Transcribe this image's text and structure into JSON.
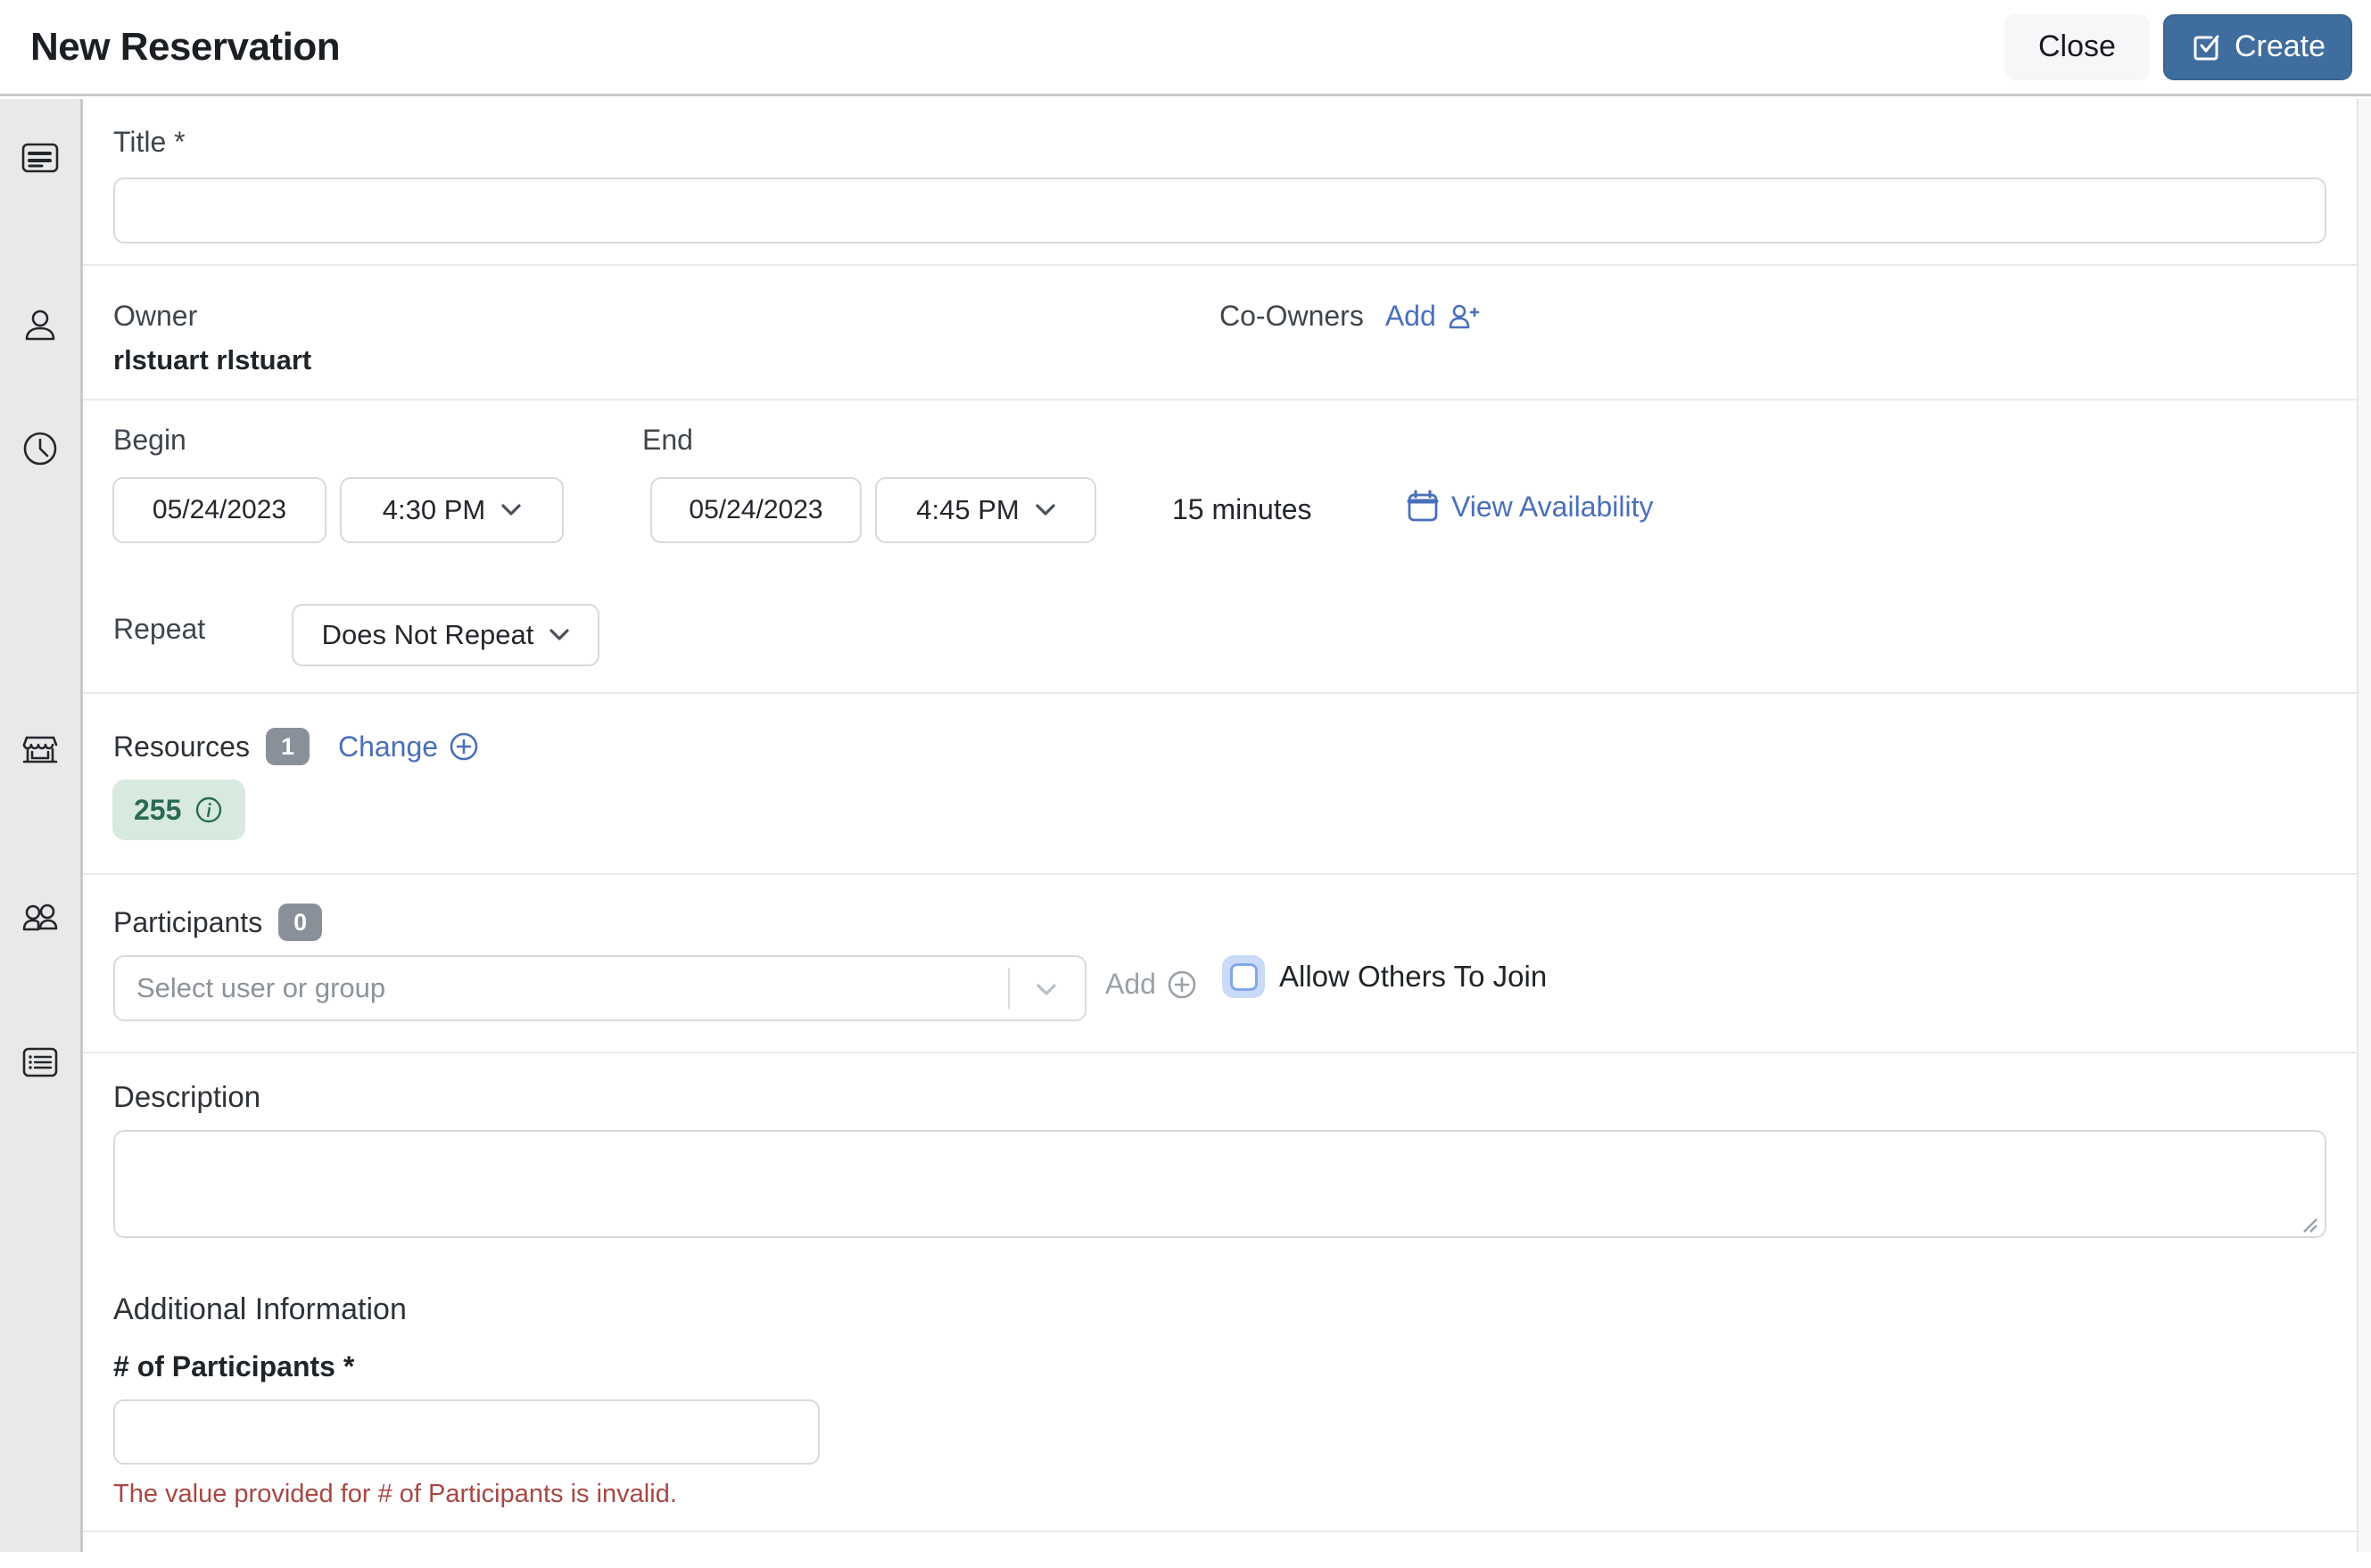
{
  "header": {
    "title": "New Reservation",
    "close_label": "Close",
    "create_label": "Create"
  },
  "colors": {
    "accent_blue": "#3f6d9e",
    "link_blue": "#4a6fba",
    "error_red": "#a84743",
    "resource_chip_bg": "#d8e9e0",
    "resource_chip_text": "#2a6a54",
    "badge_gray": "#8a909a",
    "sidebar_bg": "#e9e9e9",
    "checkbox_halo": "#c9dbf9"
  },
  "sidebar": {
    "items": [
      {
        "icon": "card-text-icon"
      },
      {
        "icon": "person-icon"
      },
      {
        "icon": "clock-icon"
      },
      {
        "icon": "storefront-icon"
      },
      {
        "icon": "people-icon"
      },
      {
        "icon": "list-card-icon"
      }
    ]
  },
  "form": {
    "title": {
      "label": "Title *",
      "value": ""
    },
    "owner": {
      "label": "Owner",
      "value": "rlstuart rlstuart"
    },
    "co_owners": {
      "label": "Co-Owners",
      "add_label": "Add"
    },
    "begin": {
      "label": "Begin",
      "date": "05/24/2023",
      "time": "4:30 PM"
    },
    "end": {
      "label": "End",
      "date": "05/24/2023",
      "time": "4:45 PM"
    },
    "duration": "15 minutes",
    "view_availability_label": "View Availability",
    "repeat": {
      "label": "Repeat",
      "value": "Does Not Repeat"
    },
    "resources": {
      "label": "Resources",
      "count": "1",
      "change_label": "Change",
      "chips": [
        {
          "name": "255"
        }
      ]
    },
    "participants": {
      "label": "Participants",
      "count": "0",
      "placeholder": "Select user or group",
      "add_label": "Add",
      "allow_label": "Allow Others To Join"
    },
    "description": {
      "label": "Description",
      "value": ""
    },
    "additional": {
      "heading": "Additional Information",
      "participants_label": "# of Participants *",
      "value": "",
      "error": "The value provided for # of Participants is invalid."
    }
  }
}
